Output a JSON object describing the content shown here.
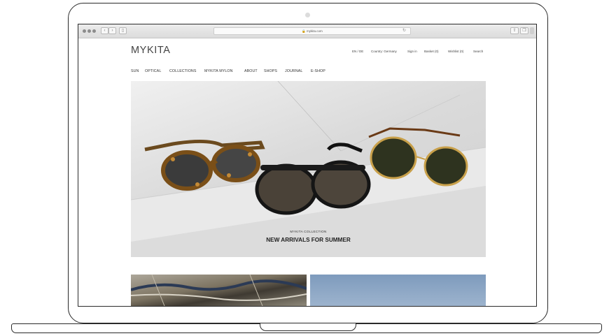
{
  "browser": {
    "url": "mykita.com",
    "icons": [
      "back-icon",
      "forward-icon",
      "sidebar-icon",
      "lock-icon",
      "reload-icon",
      "share-icon",
      "tabs-icon"
    ]
  },
  "site": {
    "logo": "MYKITA",
    "utility": {
      "language": "EN / DE",
      "country": "Country: Germany",
      "signin": "Sign in",
      "basket": "Basket (0)",
      "wishlist": "Wishlist (0)",
      "search": "Search"
    },
    "nav": [
      "SUN",
      "OPTICAL",
      "COLLECTIONS",
      "MYKITA MYLON",
      "ABOUT",
      "SHOPS",
      "JOURNAL",
      "E-SHOP"
    ],
    "hero": {
      "eyebrow": "MYKITA COLLECTION",
      "title": "NEW ARRIVALS FOR SUMMER"
    }
  }
}
